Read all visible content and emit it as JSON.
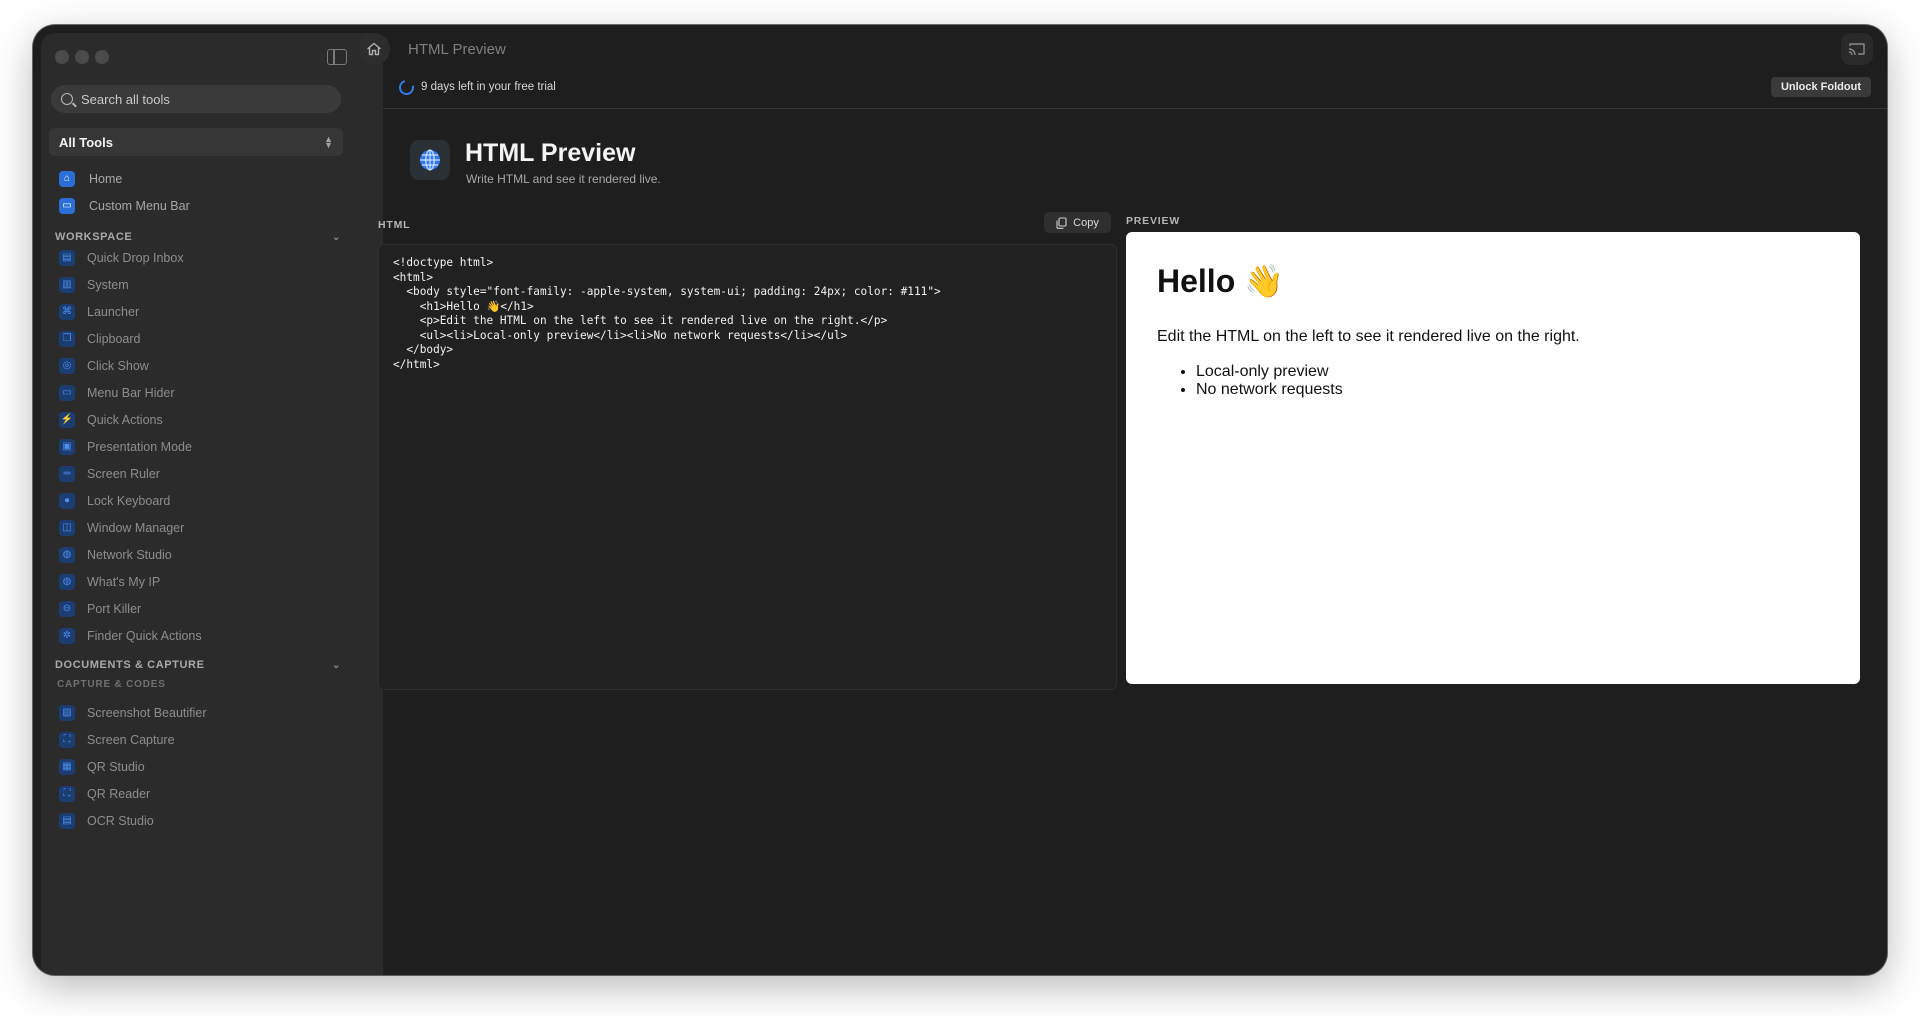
{
  "window": {
    "title": "HTML Preview"
  },
  "sidebar": {
    "search_placeholder": "Search all tools",
    "scope": "All Tools",
    "top_items": [
      {
        "label": "Home",
        "icon": "house-icon"
      },
      {
        "label": "Custom Menu Bar",
        "icon": "menubar-icon"
      }
    ],
    "sections": [
      {
        "title": "WORKSPACE",
        "items": [
          {
            "label": "Quick Drop Inbox",
            "icon": "inbox-icon"
          },
          {
            "label": "System",
            "icon": "chart-icon"
          },
          {
            "label": "Launcher",
            "icon": "command-icon"
          },
          {
            "label": "Clipboard",
            "icon": "clipboard-icon"
          },
          {
            "label": "Click Show",
            "icon": "click-icon"
          },
          {
            "label": "Menu Bar Hider",
            "icon": "window-icon"
          },
          {
            "label": "Quick Actions",
            "icon": "bolt-icon"
          },
          {
            "label": "Presentation Mode",
            "icon": "presentation-icon"
          },
          {
            "label": "Screen Ruler",
            "icon": "ruler-icon"
          },
          {
            "label": "Lock Keyboard",
            "icon": "lock-icon"
          },
          {
            "label": "Window Manager",
            "icon": "windows-icon"
          },
          {
            "label": "Network Studio",
            "icon": "globe-icon"
          },
          {
            "label": "What's My IP",
            "icon": "globe-icon"
          },
          {
            "label": "Port Killer",
            "icon": "port-icon"
          },
          {
            "label": "Finder Quick Actions",
            "icon": "gear-icon"
          }
        ]
      },
      {
        "title": "DOCUMENTS & CAPTURE",
        "subtitle": "CAPTURE & CODES",
        "items": [
          {
            "label": "Screenshot Beautifier",
            "icon": "screenshot-icon"
          },
          {
            "label": "Screen Capture",
            "icon": "capture-icon"
          },
          {
            "label": "QR Studio",
            "icon": "qr-icon"
          },
          {
            "label": "QR Reader",
            "icon": "qr-scan-icon"
          },
          {
            "label": "OCR Studio",
            "icon": "ocr-icon"
          }
        ]
      }
    ]
  },
  "trial": {
    "text": "9 days left in your free trial",
    "button": "Unlock Foldout"
  },
  "tool": {
    "title": "HTML Preview",
    "subtitle": "Write HTML and see it rendered live.",
    "html_label": "HTML",
    "copy_label": "Copy",
    "preview_label": "PREVIEW",
    "code": "<!doctype html>\n<html>\n  <body style=\"font-family: -apple-system, system-ui; padding: 24px; color: #111\">\n    <h1>Hello 👋</h1>\n    <p>Edit the HTML on the left to see it rendered live on the right.</p>\n    <ul><li>Local-only preview</li><li>No network requests</li></ul>\n  </body>\n</html>"
  },
  "preview": {
    "heading": "Hello 👋",
    "paragraph": "Edit the HTML on the left to see it rendered live on the right.",
    "list": [
      "Local-only preview",
      "No network requests"
    ]
  },
  "colors": {
    "accent": "#2f7cf0",
    "window_bg": "#1e1e1e",
    "sidebar_bg": "#2b2b2b"
  }
}
